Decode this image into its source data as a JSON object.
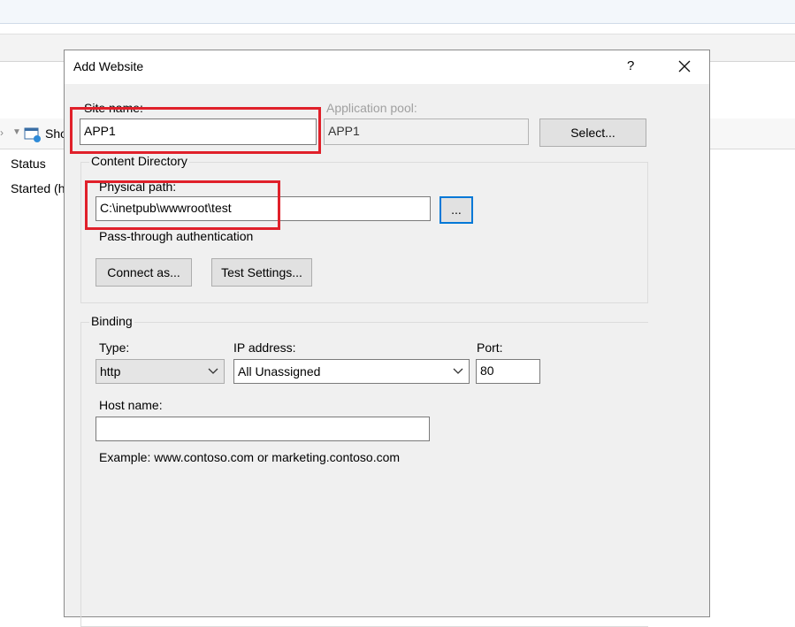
{
  "background": {
    "toolbar_show_label": "Sho",
    "status_header": "Status",
    "status_value": "Started (h"
  },
  "dialog": {
    "title": "Add Website",
    "help_label": "?",
    "site_name": {
      "label": "Site name:",
      "value": "APP1"
    },
    "app_pool": {
      "label": "Application pool:",
      "value": "APP1",
      "select_label": "Select..."
    },
    "content_directory": {
      "group_label": "Content Directory",
      "physical_path_label": "Physical path:",
      "physical_path_value": "C:\\inetpub\\wwwroot\\test",
      "browse_label": "...",
      "passthrough_label": "Pass-through authentication",
      "connect_as_label": "Connect as...",
      "test_settings_label": "Test Settings..."
    },
    "binding": {
      "group_label": "Binding",
      "type_label": "Type:",
      "type_value": "http",
      "ip_label": "IP address:",
      "ip_value": "All Unassigned",
      "port_label": "Port:",
      "port_value": "80",
      "host_label": "Host name:",
      "host_value": "",
      "example_text": "Example: www.contoso.com or marketing.contoso.com"
    }
  },
  "highlight_color": "#e0202a",
  "focus_color": "#0078d7"
}
